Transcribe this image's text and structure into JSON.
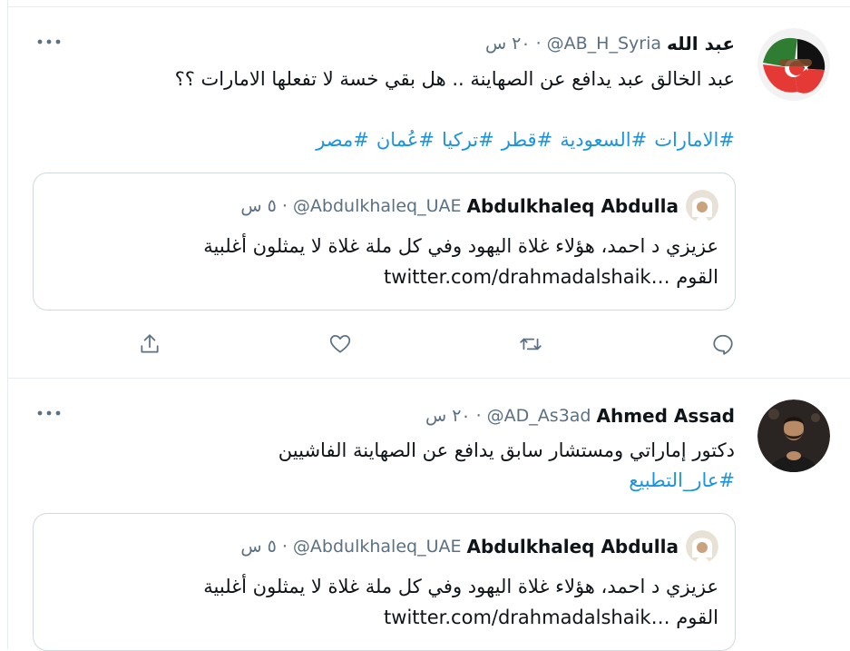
{
  "tweets": [
    {
      "author_name": "عبد الله",
      "handle": "@AB_H_Syria",
      "time": "٢٠ س",
      "text": "عبد الخالق عبد يدافع عن الصهاينة .. هل بقي خسة لا تفعلها الامارات ؟؟",
      "hashtags": [
        "#الامارات",
        "#السعودية",
        "#قطر",
        "#تركيا",
        "#عُمان",
        "#مصر"
      ],
      "quote": {
        "author_name": "Abdulkhaleq Abdulla",
        "handle": "@Abdulkhaleq_UAE",
        "time": "٥ س",
        "text_line1": "عزيزي د احمد، هؤلاء غلاة اليهود وفي كل ملة غلاة لا يمثلون أغلبية",
        "text_line2_prefix": "القوم",
        "link": "twitter.com/drahmadalshaik…"
      }
    },
    {
      "author_name": "Ahmed Assad",
      "handle": "@AD_As3ad",
      "time": "٢٠ س",
      "text": "دكتور  إماراتي ومستشار سابق يدافع عن الصهاينة الفاشيين",
      "hashtags": [
        "#عار_التطبيع"
      ],
      "quote": {
        "author_name": "Abdulkhaleq Abdulla",
        "handle": "@Abdulkhaleq_UAE",
        "time": "٥ س",
        "text_line1": "عزيزي د احمد، هؤلاء غلاة اليهود وفي كل ملة غلاة لا يمثلون أغلبية",
        "text_line2_prefix": "القوم",
        "link": "twitter.com/drahmadalshaik…"
      }
    }
  ],
  "colors": {
    "accent": "#1b95e0",
    "secondary_text": "#5b7083",
    "border": "#e6ecf0"
  },
  "icons": [
    "more-icon",
    "reply-icon",
    "retweet-icon",
    "like-icon",
    "share-icon"
  ]
}
